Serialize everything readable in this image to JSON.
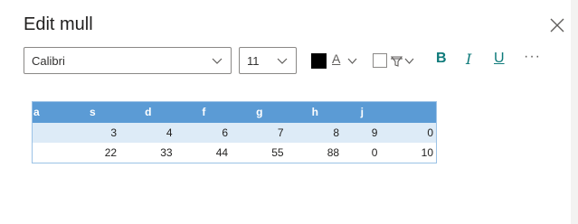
{
  "dialog": {
    "title": "Edit mull",
    "close_icon": "close-icon"
  },
  "toolbar": {
    "font": {
      "value": "Calibri",
      "icon": "chevron-down-icon"
    },
    "size": {
      "value": "11",
      "icon": "chevron-down-icon"
    },
    "fill_color": {
      "color": "#000000",
      "glyph": "A",
      "icon": "chevron-down-icon"
    },
    "border": {
      "icon": "paint-bucket-icon"
    },
    "bold_label": "B",
    "italic_label": "I",
    "underline_label": "U",
    "more_label": "···"
  },
  "table": {
    "header": [
      "a",
      "s",
      "d",
      "f",
      "g",
      "h",
      "j",
      ""
    ],
    "rows": [
      [
        "",
        "3",
        "4",
        "6",
        "7",
        "8",
        "9",
        "0"
      ],
      [
        "",
        "22",
        "33",
        "44",
        "55",
        "88",
        "0",
        "10"
      ]
    ],
    "colors": {
      "header_bg": "#5b9bd5",
      "band_bg": "#ddebf7"
    }
  }
}
